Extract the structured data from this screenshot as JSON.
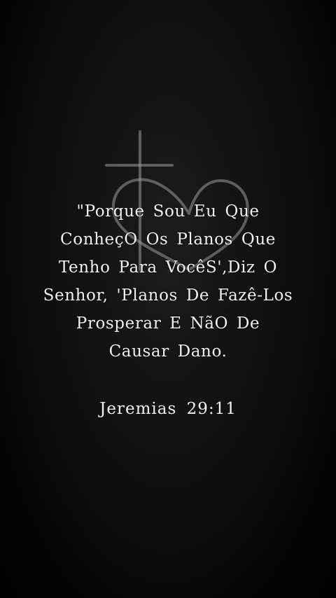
{
  "quote": {
    "lines": [
      "\"Porque Sou Eu Que",
      "ConheçO Os Planos Que",
      "Tenho Para VocêS',Diz O",
      "Senhor, 'Planos De Fazê-Los",
      "Prosperar E NãO De",
      "Causar Dano."
    ]
  },
  "reference": "Jeremias 29:11",
  "emblem": {
    "icon": "cross-heart-icon",
    "color": "#9a9a9a"
  },
  "colors": {
    "background": "#000000",
    "text": "#f2f2f2"
  }
}
